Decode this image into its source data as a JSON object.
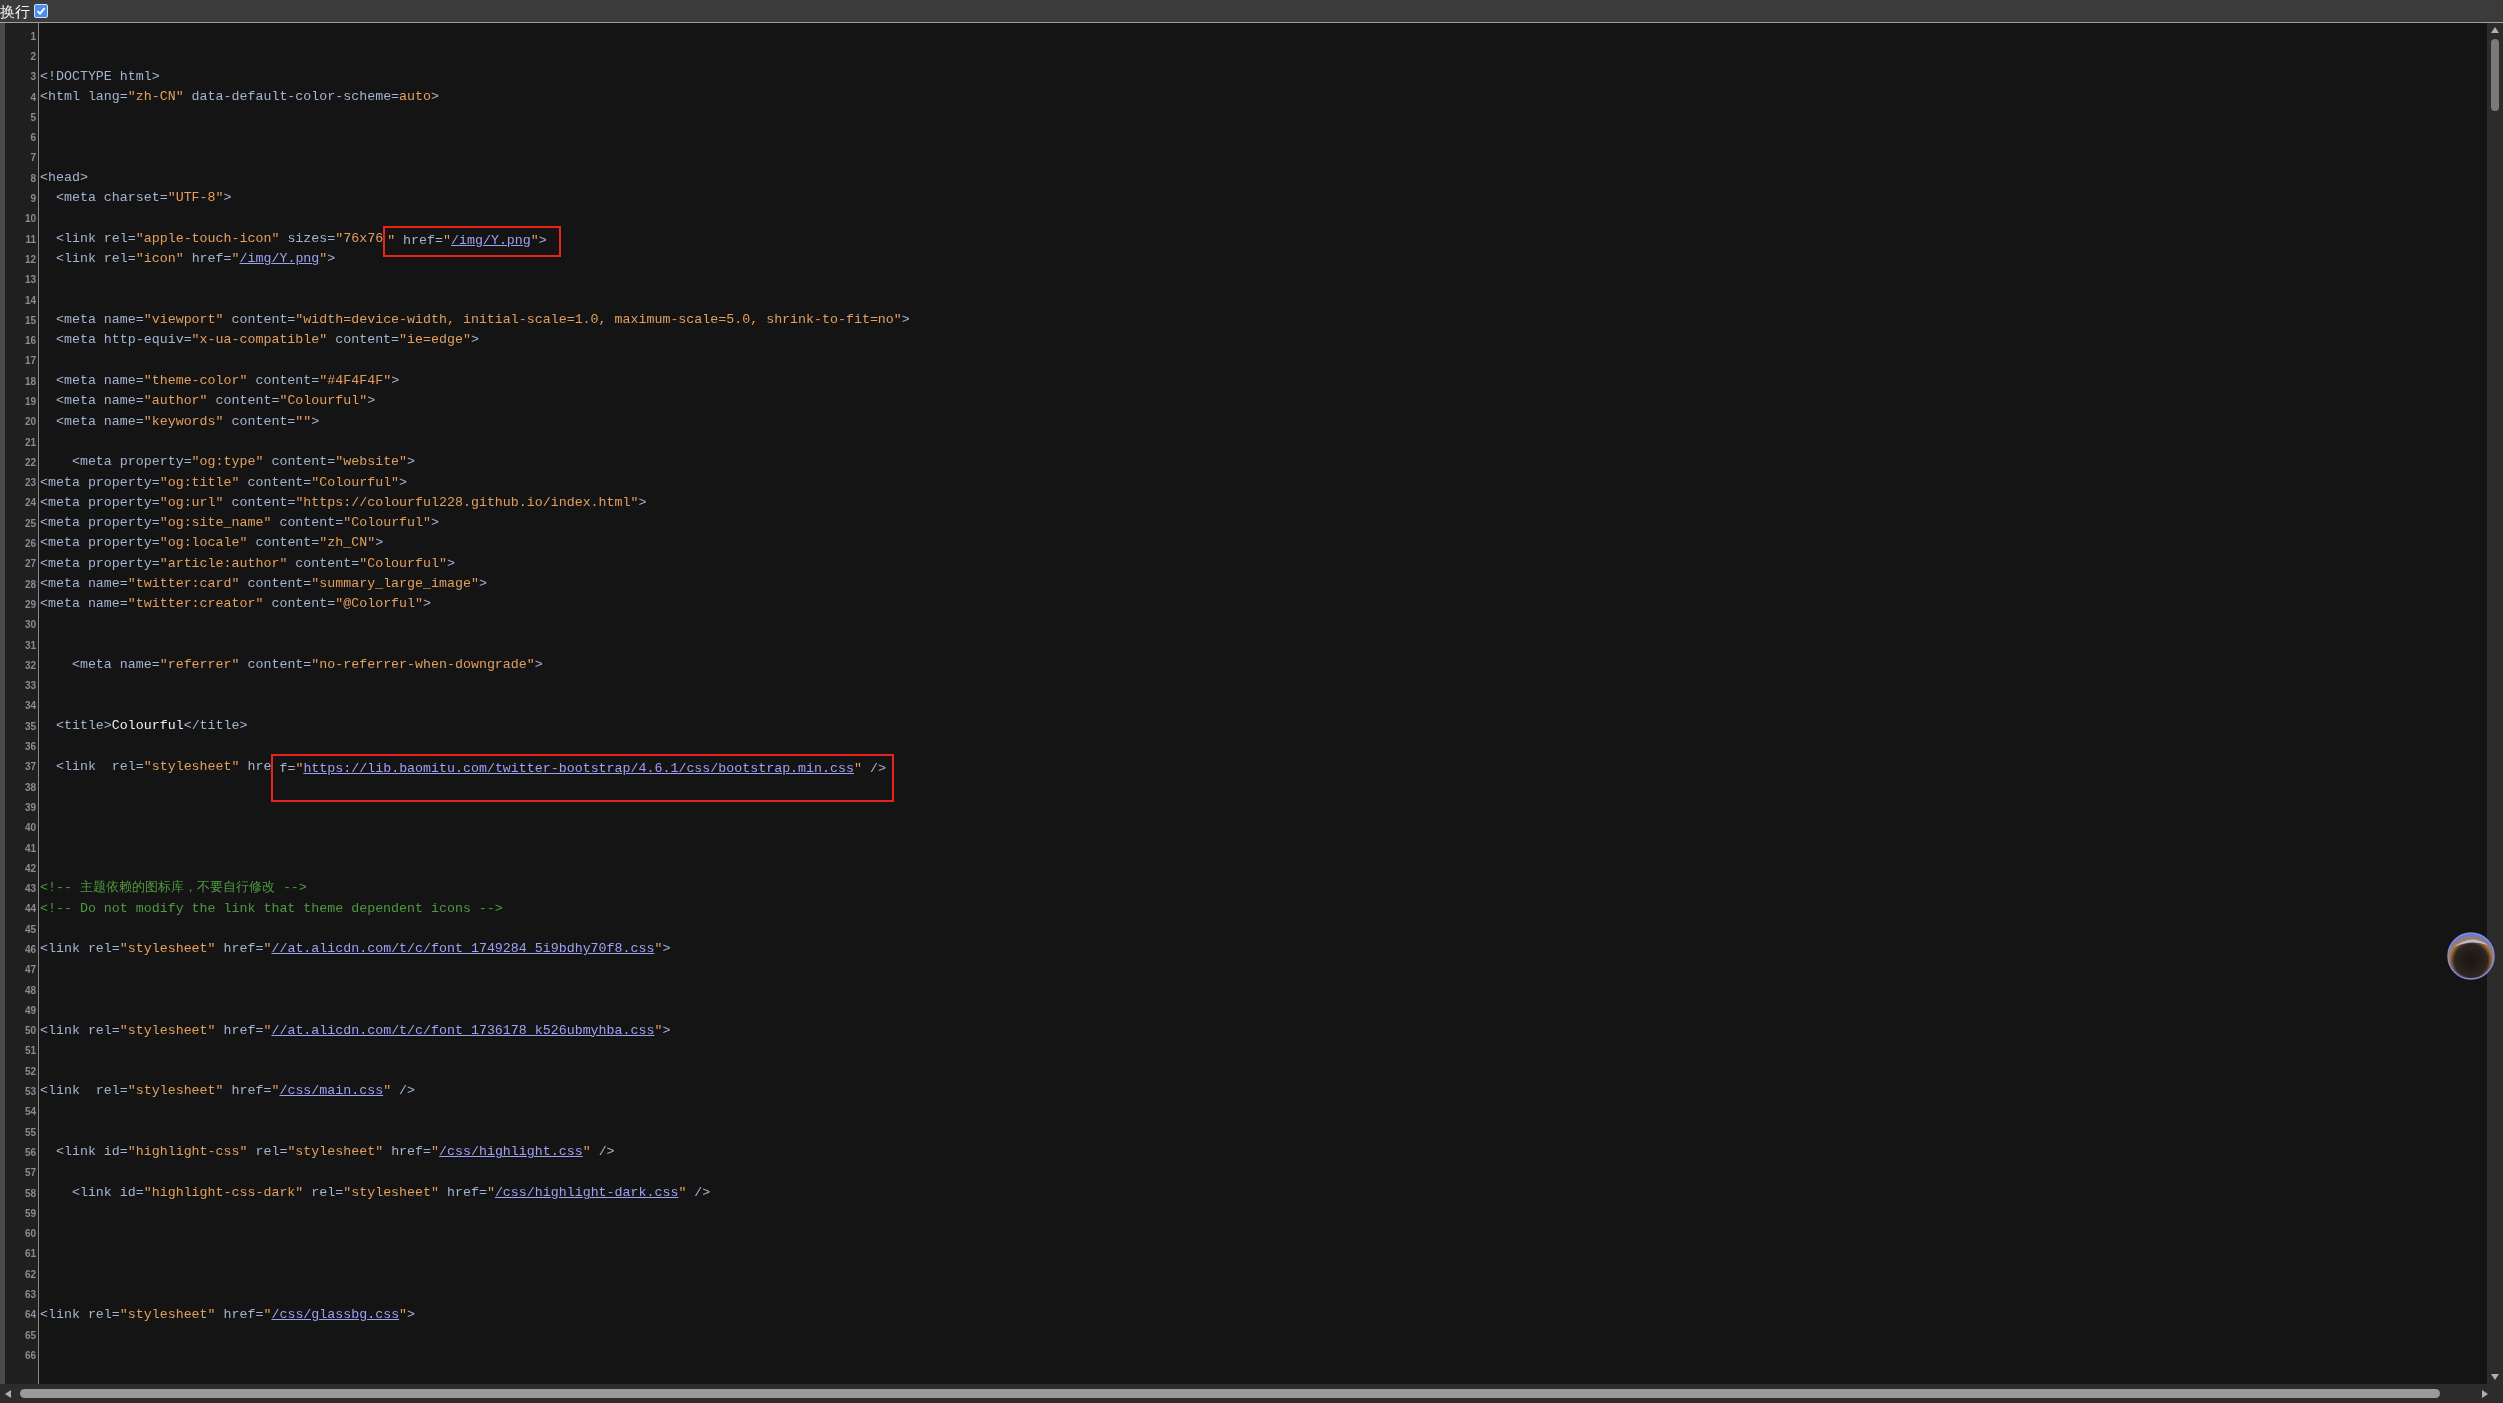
{
  "toolbar": {
    "label": "换行",
    "checked": true
  },
  "lines": [
    {
      "number": "1"
    },
    {
      "number": "2"
    },
    {
      "number": "3",
      "segments": [
        {
          "kind": "tag",
          "text": "<!DOCTYPE html>"
        }
      ]
    },
    {
      "number": "4",
      "segments": [
        {
          "kind": "tag",
          "text": "<html lang="
        },
        {
          "kind": "value",
          "text": "\"zh-CN\""
        },
        {
          "kind": "tag",
          "text": " data-default-color-scheme="
        },
        {
          "kind": "value",
          "text": "auto"
        },
        {
          "kind": "tag",
          "text": ">"
        }
      ]
    },
    {
      "number": "5"
    },
    {
      "number": "6"
    },
    {
      "number": "7"
    },
    {
      "number": "8",
      "segments": [
        {
          "kind": "tag",
          "text": "<head>"
        }
      ]
    },
    {
      "number": "9",
      "segments": [
        {
          "kind": "tag",
          "text": "  <meta charset="
        },
        {
          "kind": "value",
          "text": "\"UTF-8\""
        },
        {
          "kind": "tag",
          "text": ">"
        }
      ]
    },
    {
      "number": "10"
    },
    {
      "number": "11",
      "segments": [
        {
          "kind": "tag",
          "text": "  <link rel="
        },
        {
          "kind": "value",
          "text": "\"apple-touch-icon\""
        },
        {
          "kind": "tag",
          "text": " sizes="
        },
        {
          "kind": "value",
          "text": "\"76x76"
        },
        {
          "kind": "annotation",
          "tall": false,
          "parts": [
            {
              "kind": "value",
              "text": "\""
            },
            {
              "kind": "tag",
              "text": " href="
            },
            {
              "kind": "value",
              "text": "\""
            },
            {
              "kind": "link",
              "text": "/img/Y.png"
            },
            {
              "kind": "value",
              "text": "\""
            },
            {
              "kind": "tag",
              "text": ">"
            }
          ]
        }
      ]
    },
    {
      "number": "12",
      "segments": [
        {
          "kind": "tag",
          "text": "  <link rel="
        },
        {
          "kind": "value",
          "text": "\"icon\""
        },
        {
          "kind": "tag",
          "text": " href="
        },
        {
          "kind": "value",
          "text": "\""
        },
        {
          "kind": "link",
          "text": "/img/Y.png"
        },
        {
          "kind": "value",
          "text": "\""
        },
        {
          "kind": "tag",
          "text": ">"
        }
      ]
    },
    {
      "number": "13"
    },
    {
      "number": "14"
    },
    {
      "number": "15",
      "segments": [
        {
          "kind": "tag",
          "text": "  <meta name="
        },
        {
          "kind": "value",
          "text": "\"viewport\""
        },
        {
          "kind": "tag",
          "text": " content="
        },
        {
          "kind": "value",
          "text": "\"width=device-width, initial-scale=1.0, maximum-scale=5.0, shrink-to-fit=no\""
        },
        {
          "kind": "tag",
          "text": ">"
        }
      ]
    },
    {
      "number": "16",
      "segments": [
        {
          "kind": "tag",
          "text": "  <meta http-equiv="
        },
        {
          "kind": "value",
          "text": "\"x-ua-compatible\""
        },
        {
          "kind": "tag",
          "text": " content="
        },
        {
          "kind": "value",
          "text": "\"ie=edge\""
        },
        {
          "kind": "tag",
          "text": ">"
        }
      ]
    },
    {
      "number": "17"
    },
    {
      "number": "18",
      "segments": [
        {
          "kind": "tag",
          "text": "  <meta name="
        },
        {
          "kind": "value",
          "text": "\"theme-color\""
        },
        {
          "kind": "tag",
          "text": " content="
        },
        {
          "kind": "value",
          "text": "\"#4F4F4F\""
        },
        {
          "kind": "tag",
          "text": ">"
        }
      ]
    },
    {
      "number": "19",
      "segments": [
        {
          "kind": "tag",
          "text": "  <meta name="
        },
        {
          "kind": "value",
          "text": "\"author\""
        },
        {
          "kind": "tag",
          "text": " content="
        },
        {
          "kind": "value",
          "text": "\"Colourful\""
        },
        {
          "kind": "tag",
          "text": ">"
        }
      ]
    },
    {
      "number": "20",
      "segments": [
        {
          "kind": "tag",
          "text": "  <meta name="
        },
        {
          "kind": "value",
          "text": "\"keywords\""
        },
        {
          "kind": "tag",
          "text": " content="
        },
        {
          "kind": "value",
          "text": "\"\""
        },
        {
          "kind": "tag",
          "text": ">"
        }
      ]
    },
    {
      "number": "21"
    },
    {
      "number": "22",
      "segments": [
        {
          "kind": "tag",
          "text": "    <meta property="
        },
        {
          "kind": "value",
          "text": "\"og:type\""
        },
        {
          "kind": "tag",
          "text": " content="
        },
        {
          "kind": "value",
          "text": "\"website\""
        },
        {
          "kind": "tag",
          "text": ">"
        }
      ]
    },
    {
      "number": "23",
      "segments": [
        {
          "kind": "tag",
          "text": "<meta property="
        },
        {
          "kind": "value",
          "text": "\"og:title\""
        },
        {
          "kind": "tag",
          "text": " content="
        },
        {
          "kind": "value",
          "text": "\"Colourful\""
        },
        {
          "kind": "tag",
          "text": ">"
        }
      ]
    },
    {
      "number": "24",
      "segments": [
        {
          "kind": "tag",
          "text": "<meta property="
        },
        {
          "kind": "value",
          "text": "\"og:url\""
        },
        {
          "kind": "tag",
          "text": " content="
        },
        {
          "kind": "value",
          "text": "\"https://colourful228.github.io/index.html\""
        },
        {
          "kind": "tag",
          "text": ">"
        }
      ]
    },
    {
      "number": "25",
      "segments": [
        {
          "kind": "tag",
          "text": "<meta property="
        },
        {
          "kind": "value",
          "text": "\"og:site_name\""
        },
        {
          "kind": "tag",
          "text": " content="
        },
        {
          "kind": "value",
          "text": "\"Colourful\""
        },
        {
          "kind": "tag",
          "text": ">"
        }
      ]
    },
    {
      "number": "26",
      "segments": [
        {
          "kind": "tag",
          "text": "<meta property="
        },
        {
          "kind": "value",
          "text": "\"og:locale\""
        },
        {
          "kind": "tag",
          "text": " content="
        },
        {
          "kind": "value",
          "text": "\"zh_CN\""
        },
        {
          "kind": "tag",
          "text": ">"
        }
      ]
    },
    {
      "number": "27",
      "segments": [
        {
          "kind": "tag",
          "text": "<meta property="
        },
        {
          "kind": "value",
          "text": "\"article:author\""
        },
        {
          "kind": "tag",
          "text": " content="
        },
        {
          "kind": "value",
          "text": "\"Colourful\""
        },
        {
          "kind": "tag",
          "text": ">"
        }
      ]
    },
    {
      "number": "28",
      "segments": [
        {
          "kind": "tag",
          "text": "<meta name="
        },
        {
          "kind": "value",
          "text": "\"twitter:card\""
        },
        {
          "kind": "tag",
          "text": " content="
        },
        {
          "kind": "value",
          "text": "\"summary_large_image\""
        },
        {
          "kind": "tag",
          "text": ">"
        }
      ]
    },
    {
      "number": "29",
      "segments": [
        {
          "kind": "tag",
          "text": "<meta name="
        },
        {
          "kind": "value",
          "text": "\"twitter:creator\""
        },
        {
          "kind": "tag",
          "text": " content="
        },
        {
          "kind": "value",
          "text": "\"@Colorful\""
        },
        {
          "kind": "tag",
          "text": ">"
        }
      ]
    },
    {
      "number": "30"
    },
    {
      "number": "31"
    },
    {
      "number": "32",
      "segments": [
        {
          "kind": "tag",
          "text": "    <meta name="
        },
        {
          "kind": "value",
          "text": "\"referrer\""
        },
        {
          "kind": "tag",
          "text": " content="
        },
        {
          "kind": "value",
          "text": "\"no-referrer-when-downgrade\""
        },
        {
          "kind": "tag",
          "text": ">"
        }
      ]
    },
    {
      "number": "33"
    },
    {
      "number": "34"
    },
    {
      "number": "35",
      "segments": [
        {
          "kind": "tag",
          "text": "  <title>"
        },
        {
          "kind": "text",
          "text": "Colourful"
        },
        {
          "kind": "tag",
          "text": "</title>"
        }
      ]
    },
    {
      "number": "36"
    },
    {
      "number": "37",
      "segments": [
        {
          "kind": "tag",
          "text": "  <link  rel="
        },
        {
          "kind": "value",
          "text": "\"stylesheet\""
        },
        {
          "kind": "tag",
          "text": " hre"
        },
        {
          "kind": "annotation",
          "tall": true,
          "parts": [
            {
              "kind": "tag",
              "text": "f="
            },
            {
              "kind": "value",
              "text": "\""
            },
            {
              "kind": "link",
              "text": "https://lib.baomitu.com/twitter-bootstrap/4.6.1/css/bootstrap.min.css"
            },
            {
              "kind": "value",
              "text": "\""
            },
            {
              "kind": "tag",
              "text": " />"
            }
          ]
        }
      ]
    },
    {
      "number": "38"
    },
    {
      "number": "39"
    },
    {
      "number": "40"
    },
    {
      "number": "41"
    },
    {
      "number": "42"
    },
    {
      "number": "43",
      "segments": [
        {
          "kind": "comment",
          "text": "<!-- 主题依赖的图标库，不要自行修改 -->"
        }
      ]
    },
    {
      "number": "44",
      "segments": [
        {
          "kind": "comment",
          "text": "<!-- Do not modify the link that theme dependent icons -->"
        }
      ]
    },
    {
      "number": "45"
    },
    {
      "number": "46",
      "segments": [
        {
          "kind": "tag",
          "text": "<link rel="
        },
        {
          "kind": "value",
          "text": "\"stylesheet\""
        },
        {
          "kind": "tag",
          "text": " href="
        },
        {
          "kind": "value",
          "text": "\""
        },
        {
          "kind": "link",
          "text": "//at.alicdn.com/t/c/font_1749284_5i9bdhy70f8.css"
        },
        {
          "kind": "value",
          "text": "\""
        },
        {
          "kind": "tag",
          "text": ">"
        }
      ]
    },
    {
      "number": "47"
    },
    {
      "number": "48"
    },
    {
      "number": "49"
    },
    {
      "number": "50",
      "segments": [
        {
          "kind": "tag",
          "text": "<link rel="
        },
        {
          "kind": "value",
          "text": "\"stylesheet\""
        },
        {
          "kind": "tag",
          "text": " href="
        },
        {
          "kind": "value",
          "text": "\""
        },
        {
          "kind": "link",
          "text": "//at.alicdn.com/t/c/font_1736178_k526ubmyhba.css"
        },
        {
          "kind": "value",
          "text": "\""
        },
        {
          "kind": "tag",
          "text": ">"
        }
      ]
    },
    {
      "number": "51"
    },
    {
      "number": "52"
    },
    {
      "number": "53",
      "segments": [
        {
          "kind": "tag",
          "text": "<link  rel="
        },
        {
          "kind": "value",
          "text": "\"stylesheet\""
        },
        {
          "kind": "tag",
          "text": " href="
        },
        {
          "kind": "value",
          "text": "\""
        },
        {
          "kind": "link",
          "text": "/css/main.css"
        },
        {
          "kind": "value",
          "text": "\""
        },
        {
          "kind": "tag",
          "text": " />"
        }
      ]
    },
    {
      "number": "54"
    },
    {
      "number": "55"
    },
    {
      "number": "56",
      "segments": [
        {
          "kind": "tag",
          "text": "  <link id="
        },
        {
          "kind": "value",
          "text": "\"highlight-css\""
        },
        {
          "kind": "tag",
          "text": " rel="
        },
        {
          "kind": "value",
          "text": "\"stylesheet\""
        },
        {
          "kind": "tag",
          "text": " href="
        },
        {
          "kind": "value",
          "text": "\""
        },
        {
          "kind": "link",
          "text": "/css/highlight.css"
        },
        {
          "kind": "value",
          "text": "\""
        },
        {
          "kind": "tag",
          "text": " />"
        }
      ]
    },
    {
      "number": "57"
    },
    {
      "number": "58",
      "segments": [
        {
          "kind": "tag",
          "text": "    <link id="
        },
        {
          "kind": "value",
          "text": "\"highlight-css-dark\""
        },
        {
          "kind": "tag",
          "text": " rel="
        },
        {
          "kind": "value",
          "text": "\"stylesheet\""
        },
        {
          "kind": "tag",
          "text": " href="
        },
        {
          "kind": "value",
          "text": "\""
        },
        {
          "kind": "link",
          "text": "/css/highlight-dark.css"
        },
        {
          "kind": "value",
          "text": "\""
        },
        {
          "kind": "tag",
          "text": " />"
        }
      ]
    },
    {
      "number": "59"
    },
    {
      "number": "60"
    },
    {
      "number": "61"
    },
    {
      "number": "62"
    },
    {
      "number": "63"
    },
    {
      "number": "64",
      "segments": [
        {
          "kind": "tag",
          "text": "<link rel="
        },
        {
          "kind": "value",
          "text": "\"stylesheet\""
        },
        {
          "kind": "tag",
          "text": " href="
        },
        {
          "kind": "value",
          "text": "\""
        },
        {
          "kind": "link",
          "text": "/css/glassbg.css"
        },
        {
          "kind": "value",
          "text": "\""
        },
        {
          "kind": "tag",
          "text": ">"
        }
      ]
    },
    {
      "number": "65"
    },
    {
      "number": "66"
    }
  ]
}
